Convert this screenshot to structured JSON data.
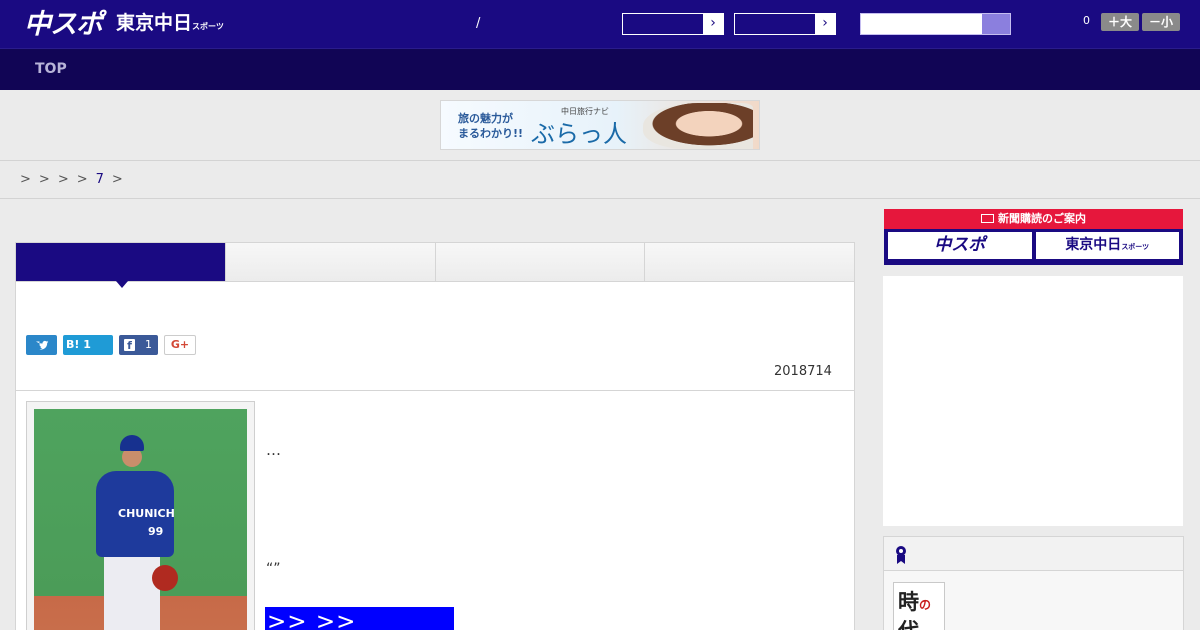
{
  "header": {
    "logo_primary": "中スポ",
    "logo_secondary": "東京中日",
    "logo_secondary_sub": "スポーツ",
    "slash": "/",
    "select_arrow": "›",
    "count": "0",
    "font_larger": "＋大",
    "font_smaller": "－小"
  },
  "nav": {
    "top": "TOP"
  },
  "ad_banner": {
    "line1": "旅の魅力が",
    "line2": "まるわかり!!",
    "small": "中日旅行ナビ",
    "brand": "ぶらっ人"
  },
  "breadcrumb": {
    "sep": ">",
    "last_link": "7"
  },
  "article": {
    "share": {
      "hatena": "B! 1",
      "facebook_count": "1",
      "gplus": "G+"
    },
    "date": "2018714",
    "photo": {
      "jersey": "CHUNICH",
      "number": "99"
    },
    "ellipsis": "…",
    "quotes": "“”",
    "link_box": ">> >>"
  },
  "sidebar": {
    "subscribe_title": "新聞購読のご案内",
    "subscribe_chunichi_sports": "中スポ",
    "subscribe_tokyo": "東京中日",
    "subscribe_tokyo_sub": "スポーツ",
    "rank_thumb_text_1": "時",
    "rank_thumb_text_red": "の",
    "rank_thumb_text_2": "代"
  },
  "colors": {
    "brand_navy": "#1a0a82",
    "nav_dark": "#110555",
    "accent_red": "#e6173c",
    "link_blue_box": "#0000ff",
    "twitter": "#2b87c9",
    "facebook": "#3b5998"
  }
}
